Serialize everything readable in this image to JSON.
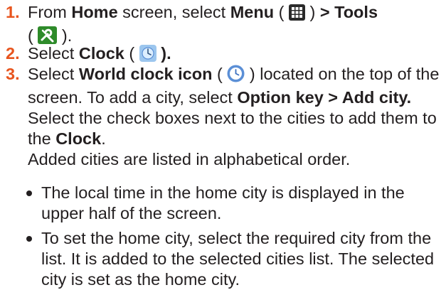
{
  "steps": [
    {
      "number": "1.",
      "t1": "From ",
      "b1": "Home",
      "t2": " screen, select ",
      "b2": "Menu",
      "t3": " ( ",
      "icon1": "menu-grid-icon",
      "t4": " ) ",
      "b3": "> Tools",
      "t5": "( ",
      "icon2": "tools-icon",
      "t6": " )."
    },
    {
      "number": "2.",
      "t1": "Select ",
      "b1": "Clock",
      "t2": " ( ",
      "icon1": "clock-icon",
      "b2": " )."
    },
    {
      "number": "3.",
      "t1": "Select ",
      "b1": "World clock icon",
      "t2": " ( ",
      "icon1": "world-clock-icon",
      "t3": " ) located on the top of the screen. To add a city, select ",
      "b2": "Option key > Add city.",
      "t4": " Select the check boxes next to the cities to add them to the ",
      "b3": "Clock",
      "t5": ".",
      "note": "Added cities are listed in alphabetical order."
    }
  ],
  "bullets": [
    "The local time in the home city is displayed in the upper half of the screen.",
    "To set the home city, select the required city from the list. It is added to the selected cities list. The selected city is set as the home city."
  ],
  "colors": {
    "step_number": "#e8541d",
    "text": "#231f20",
    "tools_green": "#2e8b2a",
    "menu_dark": "#2b2b2b",
    "clock_blue": "#5b8fd6"
  }
}
